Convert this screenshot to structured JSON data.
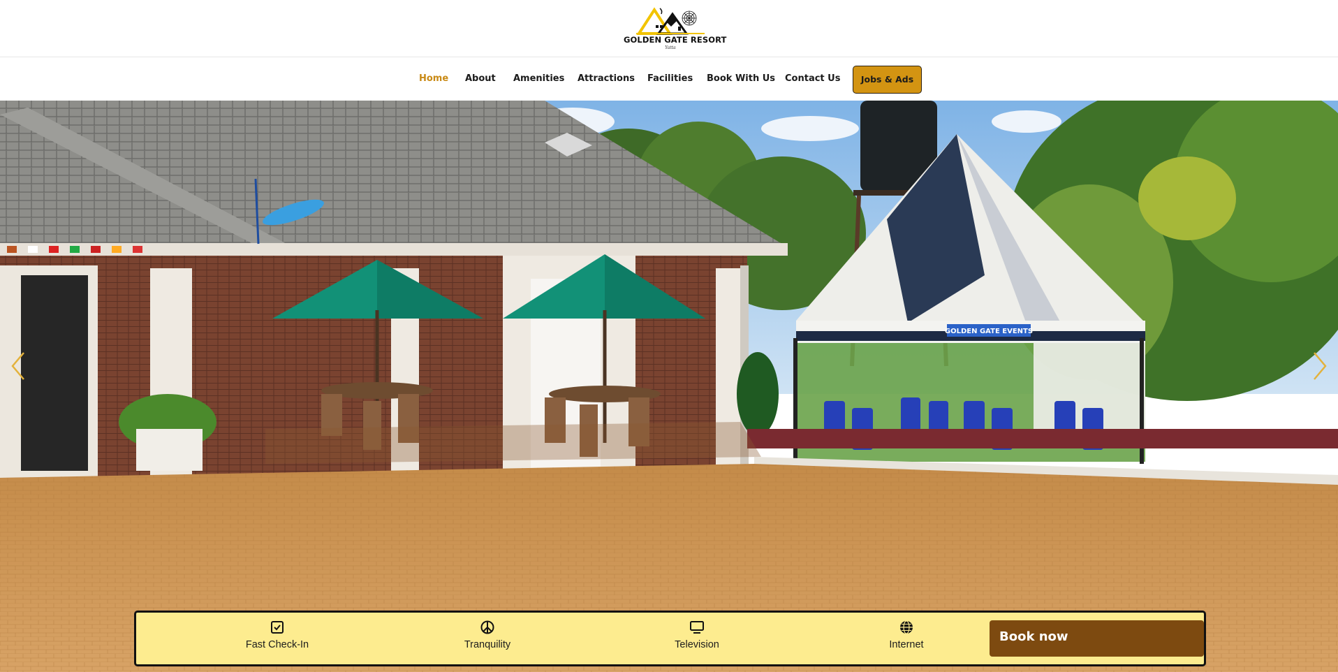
{
  "brand": {
    "name": "GOLDEN GATE RESORT",
    "tagline": "Yatta"
  },
  "nav": {
    "items": [
      {
        "label": "Home",
        "active": true
      },
      {
        "label": "About"
      },
      {
        "label": "Amenities"
      },
      {
        "label": "Attractions"
      },
      {
        "label": "Facilities"
      },
      {
        "label": "Book With Us"
      },
      {
        "label": "Contact Us"
      }
    ],
    "cta_label": "Jobs & Ads"
  },
  "hero": {
    "image": "resort-courtyard-photo",
    "tent_banner_text": "GOLDEN GATE EVENTS",
    "prev_icon": "chevron-left-icon",
    "next_icon": "chevron-right-icon"
  },
  "features": [
    {
      "label": "Fast Check-In",
      "icon": "check-square-icon"
    },
    {
      "label": "Tranquility",
      "icon": "peace-icon"
    },
    {
      "label": "Television",
      "icon": "tv-icon"
    },
    {
      "label": "Internet",
      "icon": "globe-icon"
    }
  ],
  "book_button": {
    "label": "Book now"
  },
  "colors": {
    "accent": "#d39412",
    "active_nav": "#c98a16",
    "feature_bar": "#fdec8f",
    "book_button": "#7d4a10"
  }
}
